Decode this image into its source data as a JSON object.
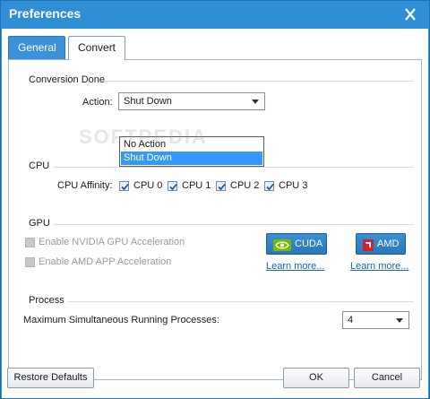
{
  "window": {
    "title": "Preferences"
  },
  "tabs": [
    {
      "label": "General"
    },
    {
      "label": "Convert"
    }
  ],
  "conversion": {
    "section_title": "Conversion Done",
    "action_label": "Action:",
    "action_value": "Shut Down",
    "options": [
      "No Action",
      "Shut Down"
    ]
  },
  "cpu": {
    "section_title": "CPU",
    "affinity_label": "CPU Affinity:",
    "cores": [
      {
        "label": "CPU 0",
        "checked": true
      },
      {
        "label": "CPU 1",
        "checked": true
      },
      {
        "label": "CPU 2",
        "checked": true
      },
      {
        "label": "CPU 3",
        "checked": true
      }
    ]
  },
  "gpu": {
    "section_title": "GPU",
    "nvidia_label": "Enable NVIDIA GPU Acceleration",
    "amd_label": "Enable AMD APP Acceleration",
    "cuda_button": "CUDA",
    "amd_button": "AMD",
    "learn_more_1": "Learn more...",
    "learn_more_2": "Learn more..."
  },
  "process": {
    "section_title": "Process",
    "max_label": "Maximum Simultaneous Running Processes:",
    "max_value": "4"
  },
  "footer": {
    "restore_label": "Restore Defaults",
    "ok_label": "OK",
    "cancel_label": "Cancel"
  },
  "watermark": "SOFTPEDIA",
  "colors": {
    "titlebar": "#2e8fd6",
    "selection": "#3399ff",
    "link": "#1a64b0",
    "cuda_green": "#76b900",
    "amd_red": "#d1202f"
  }
}
